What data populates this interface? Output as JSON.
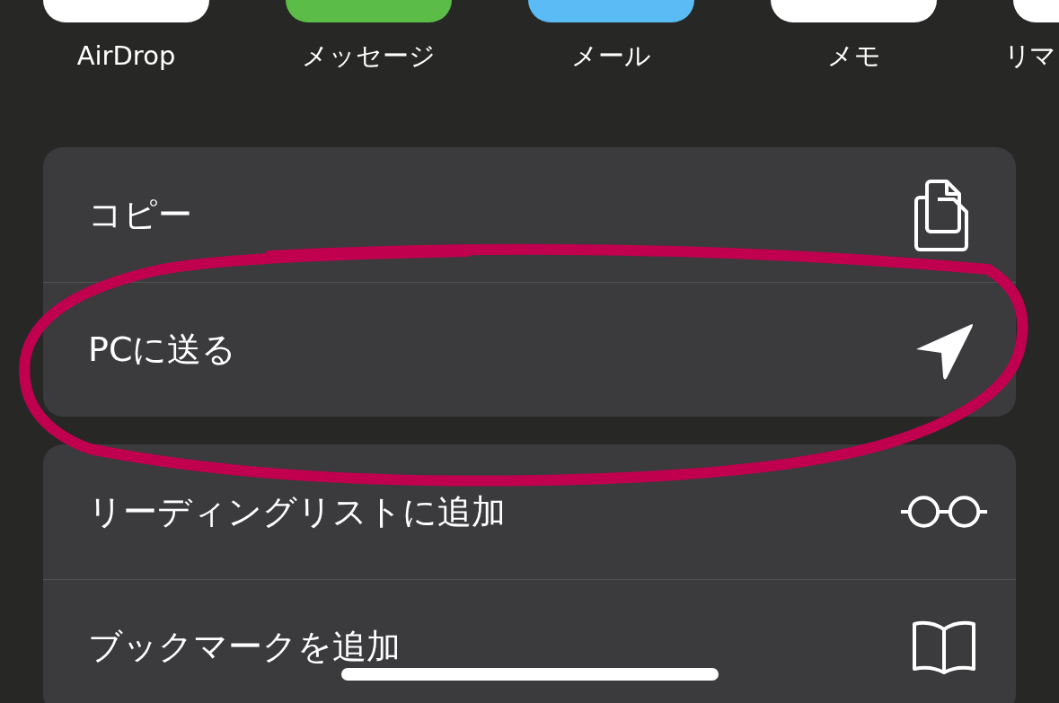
{
  "apps": [
    {
      "label": "AirDrop",
      "color": "#ffffff"
    },
    {
      "label": "メッセージ",
      "color": "#5bbd48"
    },
    {
      "label": "メール",
      "color": "#5bbcf5"
    },
    {
      "label": "メモ",
      "color": "#ffffff"
    },
    {
      "label": "リマ",
      "color": "#ffffff"
    }
  ],
  "sections": [
    {
      "items": [
        {
          "label": "コピー",
          "kind": "copy"
        },
        {
          "label": "PCに送る",
          "kind": "send"
        }
      ]
    },
    {
      "items": [
        {
          "label": "リーディングリストに追加",
          "kind": "glasses"
        },
        {
          "label": "ブックマークを追加",
          "kind": "book"
        }
      ]
    }
  ]
}
